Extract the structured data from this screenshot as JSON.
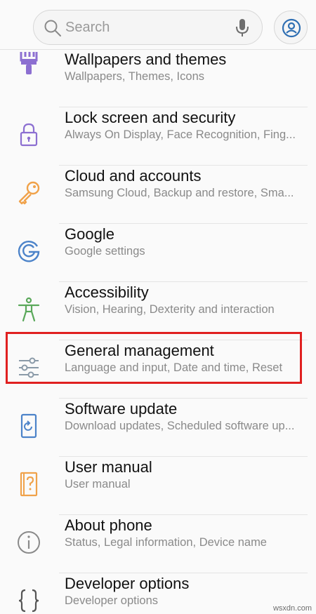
{
  "search": {
    "placeholder": "Search"
  },
  "items": [
    {
      "title": "Wallpapers and themes",
      "subtitle": "Wallpapers, Themes, Icons",
      "icon": "paintbrush-icon",
      "color": "#8c6fd1"
    },
    {
      "title": "Lock screen and security",
      "subtitle": "Always On Display, Face Recognition, Fing...",
      "icon": "lock-icon",
      "color": "#8c6fd1"
    },
    {
      "title": "Cloud and accounts",
      "subtitle": "Samsung Cloud, Backup and restore, Sma...",
      "icon": "key-icon",
      "color": "#f0a24a"
    },
    {
      "title": "Google",
      "subtitle": "Google settings",
      "icon": "google-icon",
      "color": "#4c83c9"
    },
    {
      "title": "Accessibility",
      "subtitle": "Vision, Hearing, Dexterity and interaction",
      "icon": "accessibility-icon",
      "color": "#5aa85a"
    },
    {
      "title": "General management",
      "subtitle": "Language and input, Date and time, Reset",
      "icon": "sliders-icon",
      "color": "#8090a0"
    },
    {
      "title": "Software update",
      "subtitle": "Download updates, Scheduled software up...",
      "icon": "software-update-icon",
      "color": "#4c83c9"
    },
    {
      "title": "User manual",
      "subtitle": "User manual",
      "icon": "help-book-icon",
      "color": "#f0a24a"
    },
    {
      "title": "About phone",
      "subtitle": "Status, Legal information, Device name",
      "icon": "info-icon",
      "color": "#8a8a8a"
    },
    {
      "title": "Developer options",
      "subtitle": "Developer options",
      "icon": "braces-icon",
      "color": "#555555"
    }
  ],
  "watermark": "wsxdn.com",
  "colors": {
    "highlight": "#e02020",
    "background": "#fafafa"
  }
}
